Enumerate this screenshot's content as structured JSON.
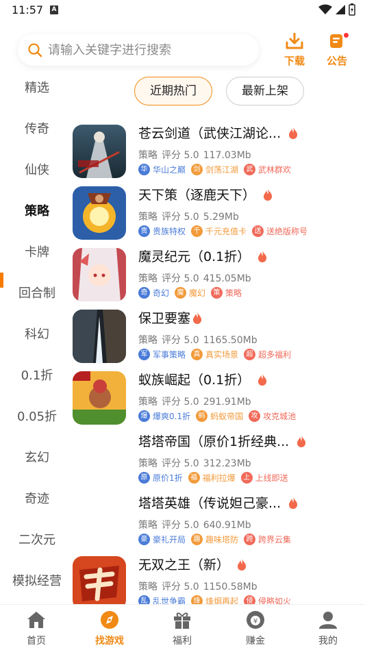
{
  "status": {
    "time": "11:57",
    "indicator": "A"
  },
  "header": {
    "search_placeholder": "请输入关键字进行搜索",
    "download_label": "下载",
    "notice_label": "公告"
  },
  "sidebar": {
    "items": [
      "精选",
      "传奇",
      "仙侠",
      "策略",
      "卡牌",
      "回合制",
      "科幻",
      "0.1折",
      "0.05折",
      "玄幻",
      "奇迹",
      "二次元",
      "模拟经营"
    ],
    "active": "策略"
  },
  "tabs": {
    "hot": "近期热门",
    "new": "最新上架",
    "active": "近期热门"
  },
  "games": [
    {
      "name": "苍云剑道（武侠江湖论...",
      "category": "策略",
      "score": "评分 5.0",
      "size": "117.03Mb",
      "tags": [
        {
          "badge": "华",
          "text": "华山之巅",
          "color": "#4a7bd8"
        },
        {
          "badge": "剑",
          "text": "剑荡江湖",
          "color": "#f29a3a"
        },
        {
          "badge": "武",
          "text": "武林群欢",
          "color": "#f06a5a"
        }
      ]
    },
    {
      "name": "天下策（逐鹿天下）",
      "category": "策略",
      "score": "评分 5.0",
      "size": "5.29Mb",
      "tags": [
        {
          "badge": "贵",
          "text": "贵族特权",
          "color": "#4a7bd8"
        },
        {
          "badge": "千",
          "text": "千元充值卡",
          "color": "#f29a3a"
        },
        {
          "badge": "送",
          "text": "送绝版称号",
          "color": "#f06a5a"
        }
      ]
    },
    {
      "name": "魔灵纪元（0.1折）",
      "category": "策略",
      "score": "评分 5.0",
      "size": "415.05Mb",
      "tags": [
        {
          "badge": "奇",
          "text": "奇幻",
          "color": "#4a7bd8"
        },
        {
          "badge": "魔",
          "text": "魔幻",
          "color": "#f29a3a"
        },
        {
          "badge": "策",
          "text": "策略",
          "color": "#f06a5a"
        }
      ]
    },
    {
      "name": "保卫要塞",
      "category": "策略",
      "score": "评分 5.0",
      "size": "1165.50Mb",
      "tags": [
        {
          "badge": "军",
          "text": "军事策略",
          "color": "#4a7bd8"
        },
        {
          "badge": "真",
          "text": "真实场景",
          "color": "#f29a3a"
        },
        {
          "badge": "超",
          "text": "超多福利",
          "color": "#f06a5a"
        }
      ]
    },
    {
      "name": "蚁族崛起（0.1折）",
      "category": "策略",
      "score": "评分 5.0",
      "size": "291.91Mb",
      "tags": [
        {
          "badge": "爆",
          "text": "爆爽0.1折",
          "color": "#4a7bd8"
        },
        {
          "badge": "蚂",
          "text": "蚂蚁帝国",
          "color": "#f29a3a"
        },
        {
          "badge": "攻",
          "text": "攻克城池",
          "color": "#f06a5a"
        }
      ]
    },
    {
      "name": "塔塔帝国（原价1折经典...",
      "category": "策略",
      "score": "评分 5.0",
      "size": "312.23Mb",
      "tags": [
        {
          "badge": "原",
          "text": "原价1折",
          "color": "#4a7bd8"
        },
        {
          "badge": "福",
          "text": "福利拉爆",
          "color": "#f29a3a"
        },
        {
          "badge": "上",
          "text": "上线即送",
          "color": "#f06a5a"
        }
      ]
    },
    {
      "name": "塔塔英雄（传说妲己豪...",
      "category": "策略",
      "score": "评分 5.0",
      "size": "640.91Mb",
      "tags": [
        {
          "badge": "豪",
          "text": "豪礼开局",
          "color": "#4a7bd8"
        },
        {
          "badge": "趣",
          "text": "趣味塔防",
          "color": "#f29a3a"
        },
        {
          "badge": "跨",
          "text": "跨界云集",
          "color": "#f06a5a"
        }
      ]
    },
    {
      "name": "无双之王（新）",
      "category": "策略",
      "score": "评分 5.0",
      "size": "1150.58Mb",
      "tags": [
        {
          "badge": "乱",
          "text": "乱世争霸",
          "color": "#4a7bd8"
        },
        {
          "badge": "烽",
          "text": "烽烟再起",
          "color": "#f29a3a"
        },
        {
          "badge": "侵",
          "text": "侵略如火",
          "color": "#f06a5a"
        }
      ]
    }
  ],
  "bottom_nav": {
    "items": [
      "首页",
      "找游戏",
      "福利",
      "赚金",
      "我的"
    ],
    "active": "找游戏"
  },
  "colors": {
    "accent": "#f08a15",
    "fire": "#f26a4b"
  }
}
